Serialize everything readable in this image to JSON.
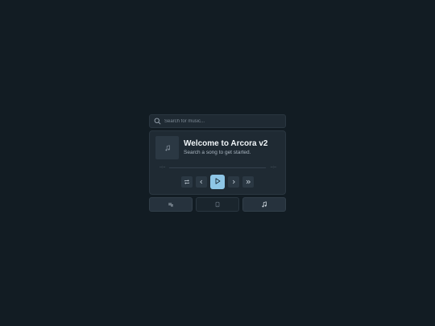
{
  "search": {
    "placeholder": "Search for music...",
    "value": ""
  },
  "now_playing": {
    "title": "Welcome to Arcora v2",
    "subtitle": "Search a song to get started.",
    "current_time": "--:--",
    "total_time": "--:--",
    "progress": 0,
    "art_icon": "music-note-icon"
  },
  "controls": [
    {
      "id": "repeat",
      "icon": "repeat-icon"
    },
    {
      "id": "previous",
      "icon": "chevron-left-icon"
    },
    {
      "id": "play",
      "icon": "play-icon"
    },
    {
      "id": "next",
      "icon": "chevron-right-icon"
    },
    {
      "id": "skip-forward",
      "icon": "double-chevron-right-icon"
    }
  ],
  "tabs": [
    {
      "id": "queue",
      "icon": "queue-list-icon",
      "active": false
    },
    {
      "id": "lyrics",
      "icon": "tablet-icon",
      "active": true
    },
    {
      "id": "library",
      "icon": "music-note-icon",
      "active": false
    }
  ],
  "colors": {
    "background": "#121c23",
    "surface": "#1f2a33",
    "accent": "#8ec6e6",
    "text": "#f0f5f8",
    "muted": "#a9b5c0"
  }
}
